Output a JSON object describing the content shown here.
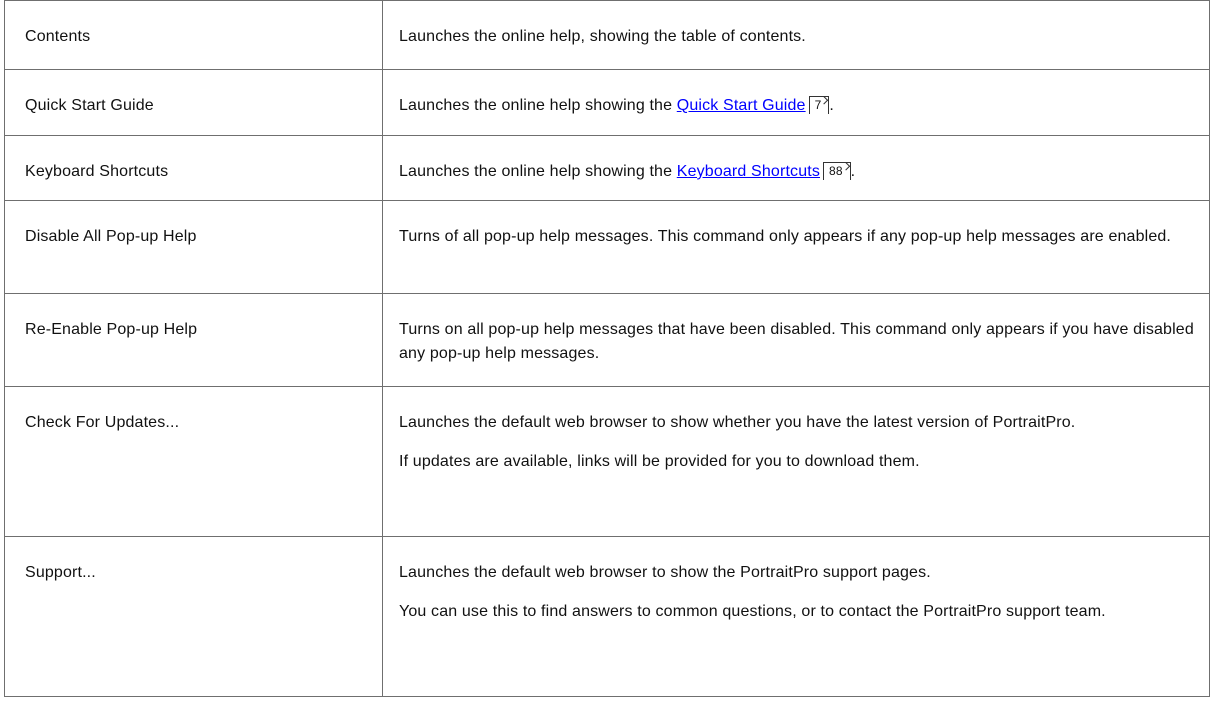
{
  "rows": [
    {
      "command": "Contents",
      "description": [
        "Launches the online help, showing the table of contents."
      ]
    },
    {
      "command": "Quick Start Guide",
      "description_prefix": "Launches the online help showing the ",
      "link_text": "Quick Start Guide",
      "page_ref": "7",
      "description_suffix": "."
    },
    {
      "command": "Keyboard Shortcuts",
      "description_prefix": "Launches the online help showing the ",
      "link_text": "Keyboard Shortcuts",
      "page_ref": "88",
      "description_suffix": "."
    },
    {
      "command": "Disable All Pop-up Help",
      "description": [
        "Turns of all pop-up help messages.  This command only appears if any pop-up help messages are enabled."
      ]
    },
    {
      "command": "Re-Enable Pop-up Help",
      "description": [
        "Turns on all pop-up help messages that have been disabled. This command only appears if you have disabled any pop-up help messages."
      ]
    },
    {
      "command": "Check For Updates...",
      "description": [
        "Launches the default web browser to show whether you have the latest version of PortraitPro.",
        "If updates are available, links will be provided for you to download them."
      ]
    },
    {
      "command": "Support...",
      "description": [
        "Launches the default web browser to show the PortraitPro support pages.",
        "You can use this to find answers to common questions, or to contact the PortraitPro support team."
      ]
    }
  ],
  "colors": {
    "link": "#0000ff",
    "border": "#6f6f6f",
    "text": "#111111"
  }
}
